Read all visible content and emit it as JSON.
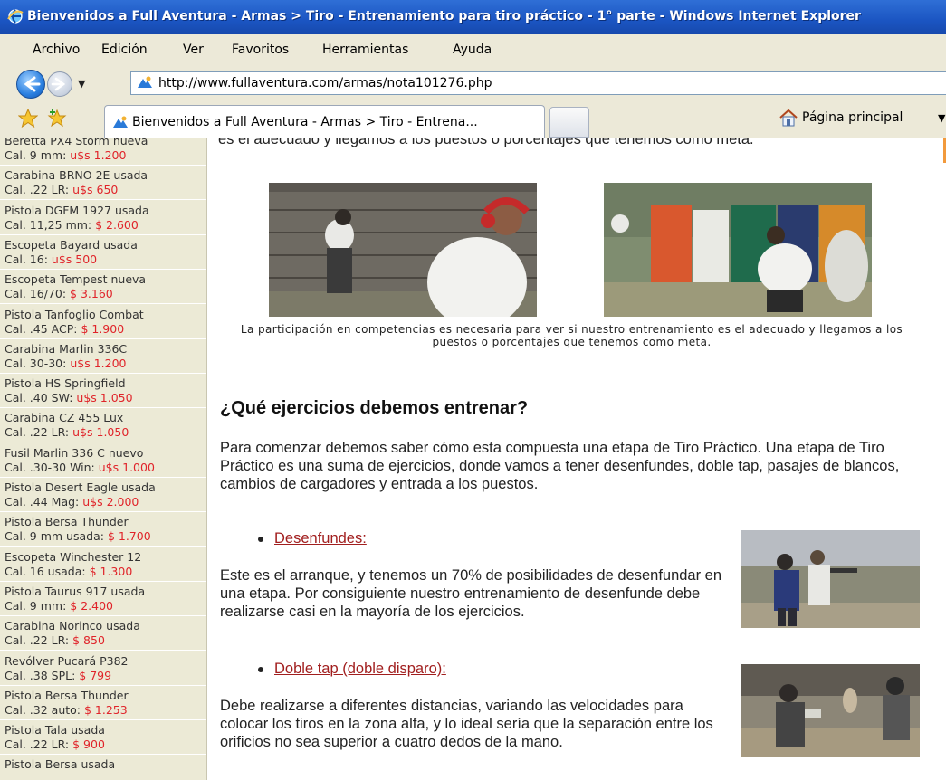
{
  "window": {
    "title": "Bienvenidos a Full Aventura - Armas > Tiro - Entrenamiento para tiro práctico - 1° parte - Windows Internet Explorer"
  },
  "menu": [
    "Archivo",
    "Edición",
    "Ver",
    "Favoritos",
    "Herramientas",
    "Ayuda"
  ],
  "address": {
    "url": "http://www.fullaventura.com/armas/nota101276.php"
  },
  "tabs": {
    "active_label": "Bienvenidos a Full Aventura - Armas > Tiro - Entrena...",
    "home_label": "Página principal"
  },
  "sidebar": {
    "items": [
      {
        "line1": "Beretta PX4 Storm nueva",
        "prefix": "Cal. 9 mm: ",
        "price": "u$s 1.200"
      },
      {
        "line1": "Carabina BRNO 2E usada",
        "prefix": "Cal. .22 LR: ",
        "price": "u$s 650"
      },
      {
        "line1": "Pistola DGFM 1927 usada",
        "prefix": "Cal. 11,25 mm: ",
        "price": "$ 2.600"
      },
      {
        "line1": "Escopeta Bayard usada",
        "prefix": "Cal. 16: ",
        "price": "u$s 500"
      },
      {
        "line1": "Escopeta Tempest nueva",
        "prefix": "Cal. 16/70: ",
        "price": "$ 3.160"
      },
      {
        "line1": "Pistola Tanfoglio Combat",
        "prefix": "Cal. .45 ACP: ",
        "price": "$ 1.900"
      },
      {
        "line1": "Carabina Marlin 336C",
        "prefix": "Cal. 30-30: ",
        "price": "u$s 1.200"
      },
      {
        "line1": "Pistola HS Springfield",
        "prefix": "Cal. .40 SW: ",
        "price": "u$s 1.050"
      },
      {
        "line1": "Carabina CZ 455 Lux",
        "prefix": "Cal. .22 LR: ",
        "price": "u$s 1.050"
      },
      {
        "line1": "Fusil Marlin 336 C nuevo",
        "prefix": "Cal. .30-30 Win: ",
        "price": "u$s 1.000"
      },
      {
        "line1": "Pistola Desert Eagle usada",
        "prefix": "Cal. .44 Mag: ",
        "price": "u$s 2.000"
      },
      {
        "line1": "Pistola Bersa Thunder",
        "prefix": "Cal. 9 mm usada: ",
        "price": "$ 1.700"
      },
      {
        "line1": "Escopeta Winchester 12",
        "prefix": "Cal. 16 usada: ",
        "price": "$ 1.300"
      },
      {
        "line1": "Pistola Taurus 917 usada",
        "prefix": "Cal. 9 mm: ",
        "price": "$ 2.400"
      },
      {
        "line1": "Carabina Norinco usada",
        "prefix": "Cal. .22 LR: ",
        "price": "$ 850"
      },
      {
        "line1": "Revólver Pucará P382",
        "prefix": "Cal. .38 SPL: ",
        "price": "$ 799"
      },
      {
        "line1": "Pistola Bersa Thunder",
        "prefix": "Cal. .32 auto: ",
        "price": "$ 1.253"
      },
      {
        "line1": "Pistola Tala usada",
        "prefix": "Cal. .22 LR: ",
        "price": "$ 900"
      },
      {
        "line1": "Pistola Bersa usada",
        "prefix": "",
        "price": ""
      }
    ]
  },
  "article": {
    "top_fragment": "es el adecuado y llegamos a los puestos o porcentajes que tenemos como meta.",
    "caption": "La participación en competencias es necesaria para ver si nuestro entrenamiento es el adecuado y llegamos a los puestos o porcentajes que tenemos como meta.",
    "heading": "¿Qué ejercicios debemos entrenar?",
    "intro": "Para comenzar debemos saber cómo esta compuesta una etapa de Tiro Práctico. Una etapa de Tiro Práctico es una suma de ejercicios, donde vamos a tener desenfundes, doble tap, pasajes de blancos, cambios de cargadores y entrada a los puestos.",
    "bullet1": "Desenfundes:",
    "para1": "Este es el arranque, y tenemos un 70% de posibilidades de desenfundar en una etapa. Por consiguiente nuestro entrenamiento de desenfunde debe realizarse casi en la mayoría de los ejercicios.",
    "bullet2": "Doble tap (doble disparo):",
    "para2": "Debe realizarse a diferentes distancias, variando las velocidades para colocar los tiros en la zona alfa, y lo ideal sería que la separación entre los orificios no sea superior a cuatro dedos de la mano."
  }
}
